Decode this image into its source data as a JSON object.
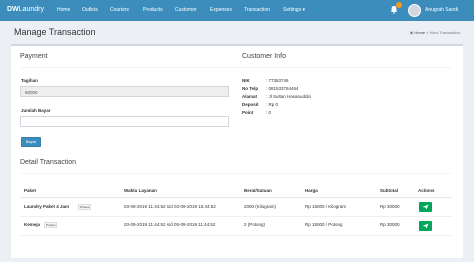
{
  "navbar": {
    "brand_bold": "DW",
    "brand_rest": "Laundry",
    "items": [
      "Home",
      "Outlets",
      "Couriers",
      "Products",
      "Customer",
      "Expenses",
      "Transaction"
    ],
    "settings": "Settings",
    "notification_count": "",
    "username": "Anugrah Sandi"
  },
  "header": {
    "title": "Manage Transaction",
    "breadcrumb_home": "Home",
    "breadcrumb_current": "View Transaction"
  },
  "payment": {
    "title": "Payment",
    "tagihan_label": "Tagihan",
    "tagihan_value": "60000",
    "jumlah_label": "Jumlah Bayar",
    "jumlah_value": "",
    "button": "Bayar"
  },
  "customer": {
    "title": "Customer Info",
    "nik_label": "NIK",
    "nik_value": ": 77363746",
    "telp_label": "No Telp",
    "telp_value": ": 081533764464",
    "alamat_label": "Alamat",
    "alamat_value": ": Jl Sultan Hasanuddin",
    "deposit_label": "Deposit",
    "deposit_value": ": Rp 0",
    "point_label": "Point",
    "point_value": ": 0"
  },
  "detail": {
    "title": "Detail Transaction",
    "columns": [
      "Paket",
      "Waktu Layanan",
      "Berat/Satuan",
      "Harga",
      "Subtotal",
      "Actions"
    ],
    "rows": [
      {
        "paket": "Laundry Paket 4 Jam",
        "badge": "Proses",
        "waktu": "03-09-2019 11:44:52 s/d 03-09-2019 15:44:52",
        "berat": "2000 (Kilogram)",
        "harga": "Rp 15000 / Kilogram",
        "subtotal": "Rp 30000"
      },
      {
        "paket": "Kemeja",
        "badge": "Proses",
        "waktu": "03-09-2019 11:44:52 s/d 05-09-2019 11:44:52",
        "berat": "2 (Potong)",
        "harga": "Rp 15000 / Potong",
        "subtotal": "Rp 30000"
      }
    ]
  },
  "colors": {
    "navbar": "#3c8dbc",
    "action_button": "#00a65a",
    "background": "#ecf0f5"
  }
}
